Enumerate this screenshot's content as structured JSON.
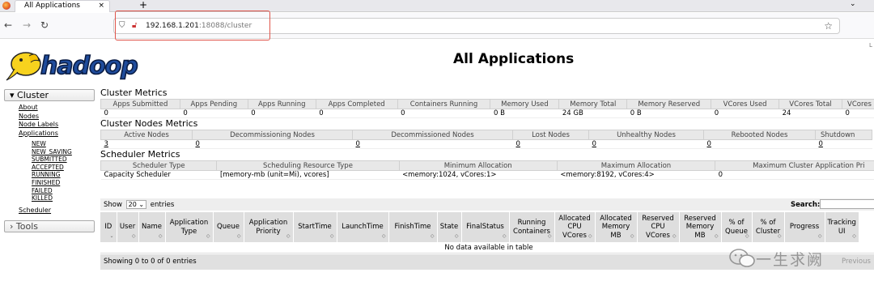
{
  "browser": {
    "tab_title": "All Applications",
    "url_host": "192.168.1.201",
    "url_rest": ":18088/cluster",
    "new_tab": "+",
    "tab_close": "×",
    "tab_menu": "⌄"
  },
  "page": {
    "title": "All Applications",
    "logo_text": "hadoop",
    "corner_letter": "L"
  },
  "sidebar": {
    "cluster_label": "Cluster",
    "links": [
      "About",
      "Nodes",
      "Node Labels",
      "Applications"
    ],
    "app_states": [
      "NEW",
      "NEW_SAVING",
      "SUBMITTED",
      "ACCEPTED",
      "RUNNING",
      "FINISHED",
      "FAILED",
      "KILLED"
    ],
    "scheduler": "Scheduler",
    "tools_label": "Tools"
  },
  "cluster_metrics": {
    "heading": "Cluster Metrics",
    "headers": [
      "Apps Submitted",
      "Apps Pending",
      "Apps Running",
      "Apps Completed",
      "Containers Running",
      "Memory Used",
      "Memory Total",
      "Memory Reserved",
      "VCores Used",
      "VCores Total",
      "VCores"
    ],
    "values": [
      "0",
      "0",
      "0",
      "0",
      "0",
      "0 B",
      "24 GB",
      "0 B",
      "0",
      "24",
      "0"
    ]
  },
  "nodes_metrics": {
    "heading": "Cluster Nodes Metrics",
    "headers": [
      "Active Nodes",
      "Decommissioning Nodes",
      "Decommissioned Nodes",
      "Lost Nodes",
      "Unhealthy Nodes",
      "Rebooted Nodes",
      "Shutdown"
    ],
    "values": [
      "3",
      "0",
      "0",
      "0",
      "0",
      "0",
      "0"
    ]
  },
  "scheduler_metrics": {
    "heading": "Scheduler Metrics",
    "headers": [
      "Scheduler Type",
      "Scheduling Resource Type",
      "Minimum Allocation",
      "Maximum Allocation",
      "Maximum Cluster Application Pri"
    ],
    "values": [
      "Capacity Scheduler",
      "[memory-mb (unit=Mi), vcores]",
      "<memory:1024, vCores:1>",
      "<memory:8192, vCores:4>",
      "0"
    ]
  },
  "table_controls": {
    "show": "Show",
    "page_size": "20",
    "entries": "entries",
    "search_label": "Search:"
  },
  "apps_table": {
    "headers": [
      "ID",
      "User",
      "Name",
      "Application Type",
      "Queue",
      "Application Priority",
      "StartTime",
      "LaunchTime",
      "FinishTime",
      "State",
      "FinalStatus",
      "Running Containers",
      "Allocated CPU VCores",
      "Allocated Memory MB",
      "Reserved CPU VCores",
      "Reserved Memory MB",
      "% of Queue",
      "% of Cluster",
      "Progress",
      "Tracking UI"
    ],
    "empty_message": "No data available in table",
    "info": "Showing 0 to 0 of 0 entries",
    "previous": "Previous"
  },
  "watermark": {
    "text": "一生求阙"
  }
}
